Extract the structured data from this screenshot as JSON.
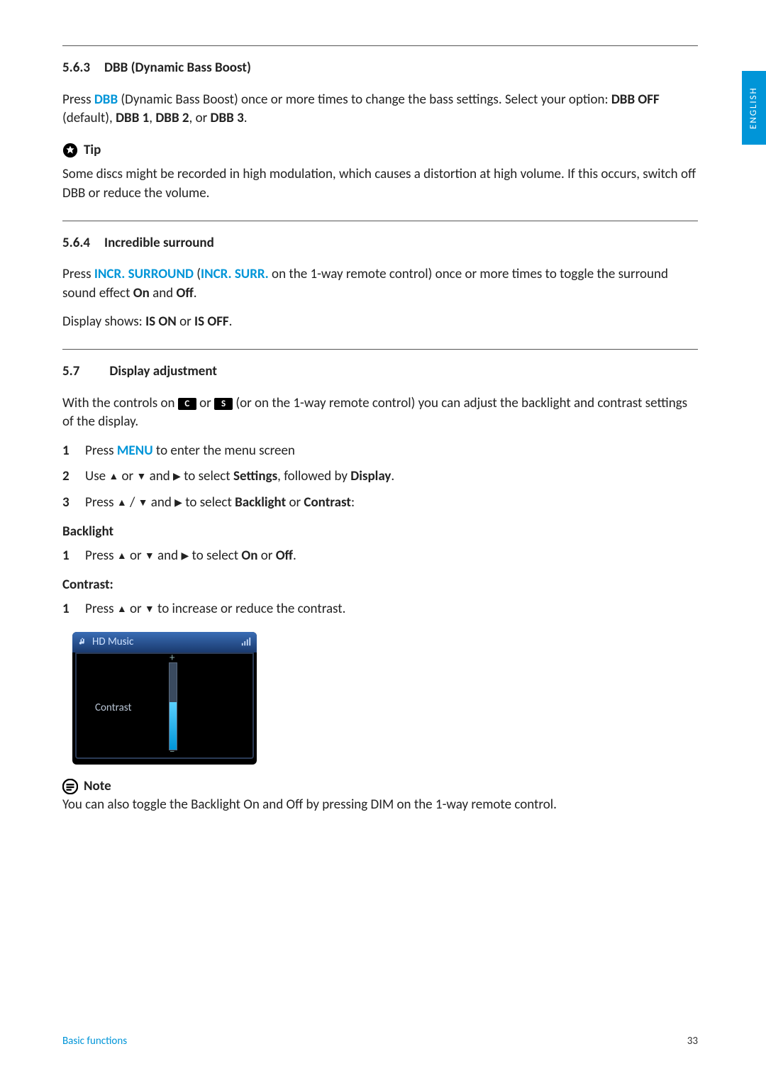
{
  "lang_tab": "ENGLISH",
  "sec563": {
    "num": "5.6.3",
    "title": "DBB (Dynamic Bass Boost)",
    "p1_pre": "Press ",
    "p1_dbb": "DBB",
    "p1_mid": " (Dynamic Bass Boost) once or more times to change the bass settings. Select your option: ",
    "p1_o1": "DBB OFF",
    "p1_def": " (default), ",
    "p1_o2": "DBB 1",
    "p1_c1": ", ",
    "p1_o3": "DBB 2",
    "p1_c2": ", or ",
    "p1_o4": "DBB 3",
    "p1_end": ".",
    "tip_label": "Tip",
    "tip_body": "Some discs might be recorded in high modulation, which causes a distortion at high volume. If this occurs, switch off DBB or reduce the volume."
  },
  "sec564": {
    "num": "5.6.4",
    "title": "Incredible surround",
    "p1_pre": "Press ",
    "p1_b1": "INCR. SURROUND",
    "p1_par_open": " (",
    "p1_b2": "INCR. SURR.",
    "p1_mid": " on the 1-way remote control) once or more times to toggle the surround sound effect ",
    "p1_on": "On",
    "p1_and": " and ",
    "p1_off": "Off",
    "p1_end": ".",
    "p2_pre": "Display shows: ",
    "p2_a": "IS ON",
    "p2_or": " or ",
    "p2_b": "IS OFF",
    "p2_end": "."
  },
  "sec57": {
    "num": "5.7",
    "title": "Display adjustment",
    "p1_pre": "With the controls on ",
    "p1_c": "C",
    "p1_or": " or ",
    "p1_s": "S",
    "p1_rest": " (or on the 1-way remote control) you can adjust the backlight and contrast settings of the display.",
    "li1_pre": "Press ",
    "li1_menu": "MENU",
    "li1_post": " to enter the menu screen",
    "li2_pre": "Use ",
    "li2_mid1": " or ",
    "li2_mid2": " and ",
    "li2_mid3": " to select ",
    "li2_set": "Settings",
    "li2_fby": ", followed by ",
    "li2_disp": "Display",
    "li2_end": ".",
    "li3_pre": "Press ",
    "li3_mid1": " / ",
    "li3_mid2": " and ",
    "li3_mid3": " to select ",
    "li3_a": "Backlight",
    "li3_or": " or ",
    "li3_b": "Contrast",
    "li3_end": ":",
    "bl_head": "Backlight",
    "bl_li_pre": "Press ",
    "bl_li_mid1": " or ",
    "bl_li_mid2": " and ",
    "bl_li_mid3": " to select ",
    "bl_li_on": "On",
    "bl_li_or": " or ",
    "bl_li_off": "Off",
    "bl_li_end": ".",
    "ct_head": "Contrast:",
    "ct_li_pre": "Press ",
    "ct_li_mid": " or ",
    "ct_li_post": " to increase or reduce the contrast.",
    "shot_title": "HD Music",
    "shot_label": "Contrast",
    "note_label": "Note",
    "note_body": "You can also toggle the Backlight On and Off by pressing DIM on the 1-way remote control."
  },
  "footer": {
    "left": "Basic functions",
    "page": "33"
  },
  "nums": {
    "n1": "1",
    "n2": "2",
    "n3": "3"
  }
}
